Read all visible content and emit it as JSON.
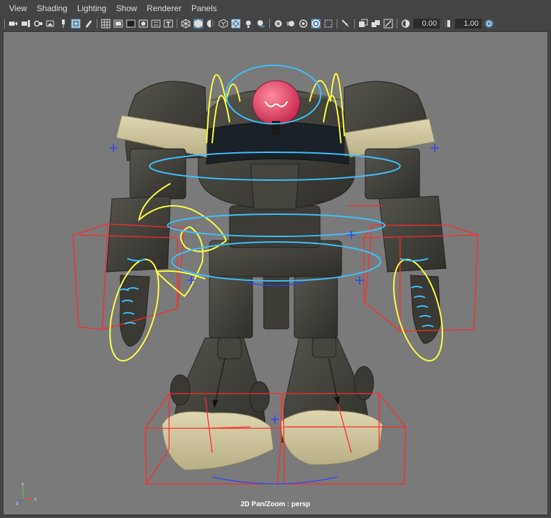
{
  "menubar": {
    "items": [
      "View",
      "Shading",
      "Lighting",
      "Show",
      "Renderer",
      "Panels"
    ]
  },
  "toolbar": {
    "exposure_value": "0.00",
    "gamma_value": "1.00",
    "icons": [
      "select-camera",
      "camera-attributes",
      "bookmarks",
      "image-plane",
      "2d-pan-zoom",
      "grease-pencil",
      "grid",
      "film-gate",
      "resolution-gate",
      "gate-mask",
      "field-chart",
      "safe-action",
      "safe-title",
      "wireframe",
      "smooth-shade",
      "default-material",
      "xray",
      "use-all-lights",
      "shadows",
      "screen-space-ao",
      "motion-blur",
      "multisample-aa",
      "depth-of-field",
      "isolate-select",
      "xray-joints",
      "xray-active",
      "backface-culling",
      "exposure",
      "gamma",
      "color-management"
    ]
  },
  "viewport": {
    "camera_label": "2D Pan/Zoom : persp",
    "background_color": "#7a7a7a"
  },
  "axis": {
    "x_label": "x",
    "y_label": "y",
    "z_label": "z"
  },
  "colors": {
    "ui_bg": "#444444",
    "accent": "#5285a6",
    "ctrl_yellow": "#ffff40",
    "ctrl_blue": "#3fc0ff",
    "ctrl_red": "#ff2a2a",
    "robot_dark": "#3e3d37",
    "robot_tan": "#cbc39c",
    "head_pink": "#d83a5a"
  }
}
